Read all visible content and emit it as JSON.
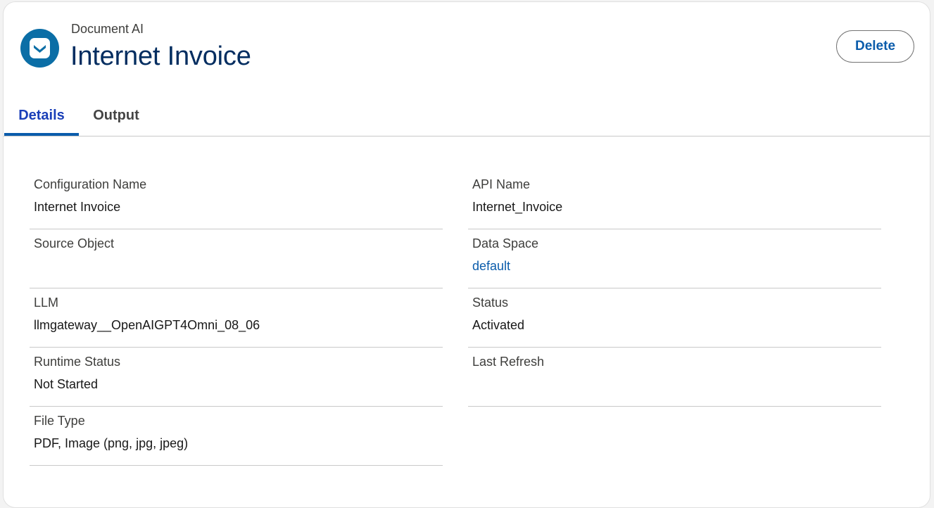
{
  "header": {
    "eyebrow": "Document AI",
    "title": "Internet Invoice",
    "icon": "document-ai-icon",
    "delete_label": "Delete"
  },
  "tabs": [
    {
      "label": "Details",
      "active": true
    },
    {
      "label": "Output",
      "active": false
    }
  ],
  "fields": {
    "configuration_name": {
      "label": "Configuration Name",
      "value": "Internet Invoice"
    },
    "api_name": {
      "label": "API Name",
      "value": "Internet_Invoice"
    },
    "source_object": {
      "label": "Source Object",
      "value": ""
    },
    "data_space": {
      "label": "Data Space",
      "value": "default"
    },
    "llm": {
      "label": "LLM",
      "value": "llmgateway__OpenAIGPT4Omni_08_06"
    },
    "status": {
      "label": "Status",
      "value": "Activated"
    },
    "runtime_status": {
      "label": "Runtime Status",
      "value": "Not Started"
    },
    "last_refresh": {
      "label": "Last Refresh",
      "value": ""
    },
    "file_type": {
      "label": "File Type",
      "value": "PDF, Image (png, jpg, jpeg)"
    }
  },
  "colors": {
    "brand_blue": "#0b5cab",
    "title_navy": "#032d60",
    "icon_bg": "#0b6ea6"
  }
}
